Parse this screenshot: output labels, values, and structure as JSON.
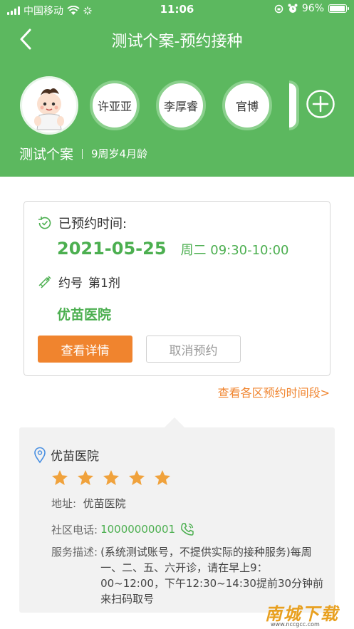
{
  "status_bar": {
    "carrier": "中国移动",
    "time": "11:06",
    "battery": "96%",
    "battery_level": 0.96
  },
  "nav": {
    "title": "测试个案-预约接种",
    "back_icon": "chevron-left-icon"
  },
  "profiles": {
    "current_avatar_icon": "baby-avatar-icon",
    "others": [
      "许亚亚",
      "李厚睿",
      "官博"
    ],
    "add_icon": "plus-circle-icon"
  },
  "child": {
    "name": "测试个案",
    "age": "9周岁4月龄"
  },
  "appointment": {
    "label": "已预约时间:",
    "date": "2021-05-25",
    "time": "周二 09:30-10:00",
    "dose_label": "约号",
    "dose_value": "第1剂",
    "hospital": "优苗医院",
    "detail_button": "查看详情",
    "cancel_button": "取消预约"
  },
  "periods_link": "查看各区预约时间段>",
  "hospital_card": {
    "name": "优苗医院",
    "rating": 5,
    "address_label": "地址:",
    "address": "优苗医院",
    "phone_label": "社区电话:",
    "phone": "10000000001",
    "desc_label": "服务描述:",
    "desc": "(系统测试账号，不提供实际的接种服务)每周一、二、五、六开诊，请在早上9：00~12:00，下午12:30~14:30提前30分钟前来扫码取号"
  },
  "watermark": {
    "text": "南城下载",
    "sub": "www.nccgcc.com"
  },
  "colors": {
    "brand_green": "#5cb85f",
    "accent_orange": "#f0842e",
    "text_green": "#4caf50"
  }
}
